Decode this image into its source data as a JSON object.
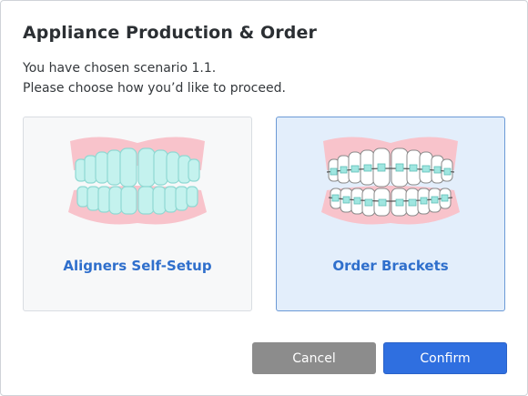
{
  "dialog": {
    "title": "Appliance Production & Order",
    "line1": "You have chosen scenario 1.1.",
    "line2": "Please choose how you’d like to proceed."
  },
  "options": [
    {
      "label": "Aligners Self-Setup",
      "icon": "aligner-teeth-icon",
      "selected": false
    },
    {
      "label": "Order Brackets",
      "icon": "braces-teeth-icon",
      "selected": true
    }
  ],
  "buttons": {
    "cancel": "Cancel",
    "confirm": "Confirm"
  },
  "colors": {
    "accent": "#2f6fe0",
    "selected_bg": "#e3eefb",
    "gum": "#f8c3cb",
    "aligner": "#bff0ec",
    "cancel_bg": "#8c8c8c"
  }
}
